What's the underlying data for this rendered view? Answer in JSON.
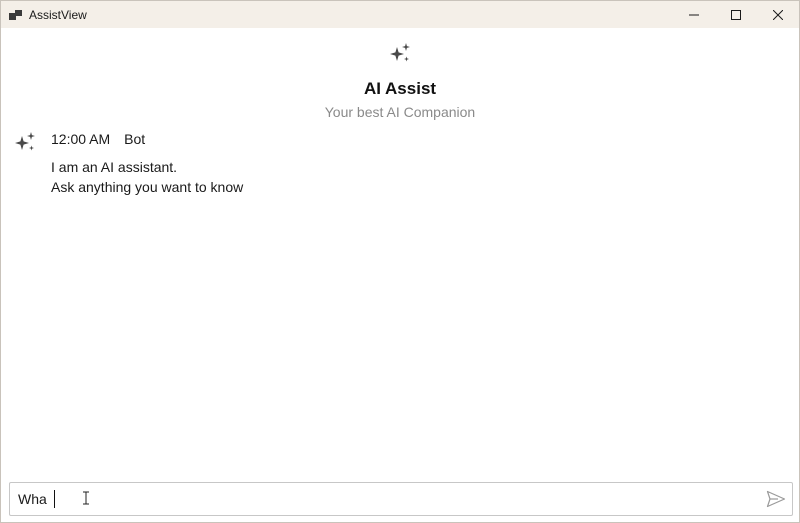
{
  "window": {
    "title": "AssistView",
    "controls": [
      "minimize-icon",
      "maximize-icon",
      "close-icon"
    ]
  },
  "header": {
    "icon": "sparkle-icon",
    "title": "AI Assist",
    "subtitle": "Your best AI Companion"
  },
  "messages": [
    {
      "avatar_icon": "sparkle-icon",
      "time": "12:00 AM",
      "author": "Bot",
      "lines": [
        "I am an AI assistant.",
        "Ask anything you want to know"
      ]
    }
  ],
  "composer": {
    "value": "Wha",
    "send_icon": "send-icon"
  },
  "colors": {
    "titlebar": "#f4efe8",
    "subtitle": "#8a8a8a",
    "icon": "#4a4a4a",
    "send_icon": "#9a9a9a"
  }
}
